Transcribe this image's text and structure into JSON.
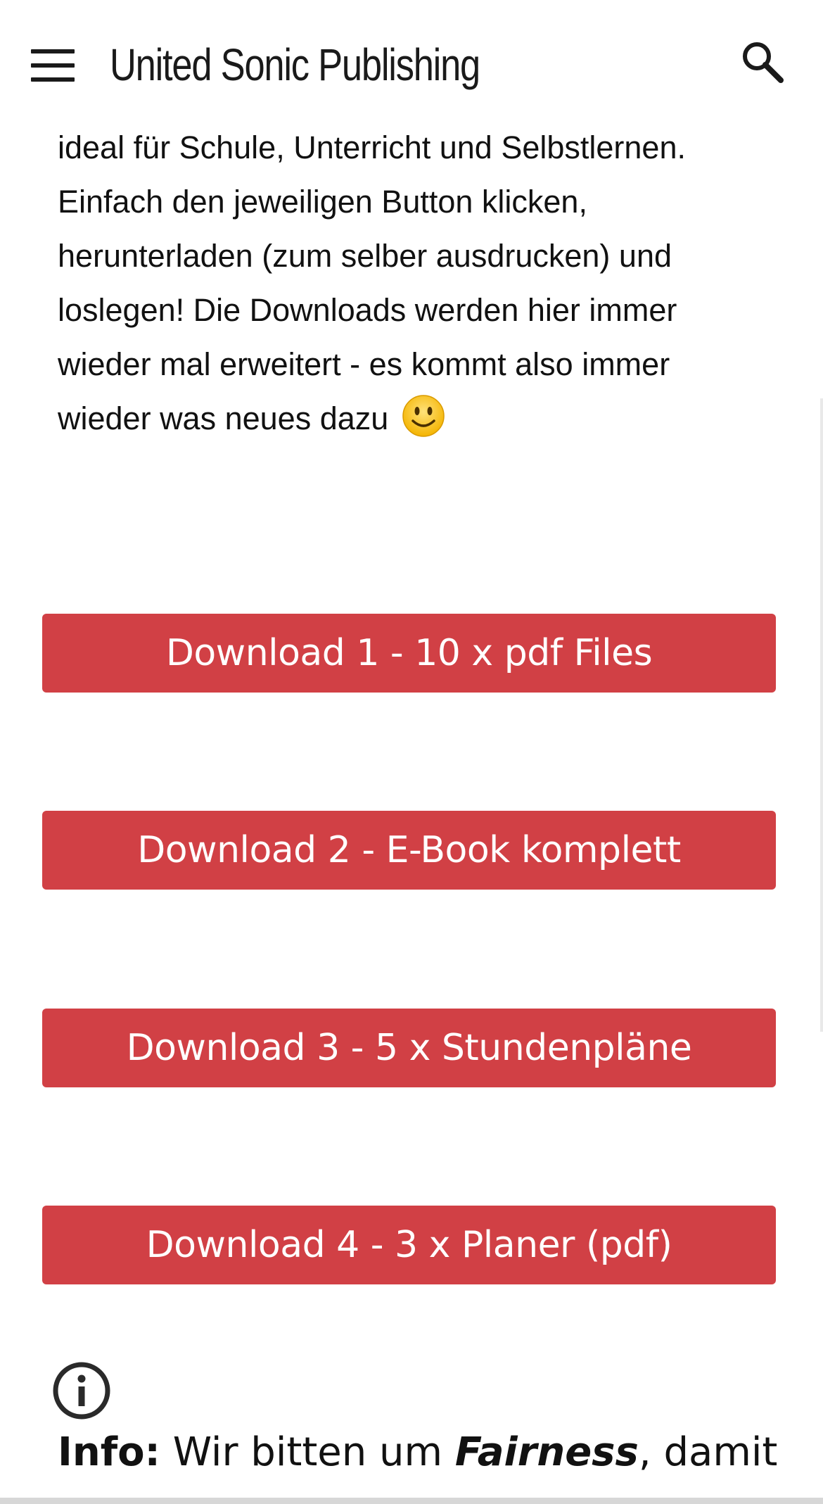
{
  "header": {
    "menu_icon": "hamburger-menu-icon",
    "title": "United Sonic Publishing",
    "search_icon": "search-icon"
  },
  "intro": {
    "lines": [
      "ideal für Schule, Unterricht und Selbstlernen.",
      "Einfach den jeweiligen Button klicken,",
      "herunterladen (zum selber ausdrucken) und",
      "loslegen! Die Downloads werden hier immer",
      "wieder mal erweitert - es kommt also immer",
      "wieder was neues dazu"
    ],
    "emoji_icon": "smiley-face-icon"
  },
  "downloads": [
    {
      "label": "Download 1 - 10 x pdf Files"
    },
    {
      "label": "Download 2 - E-Book komplett"
    },
    {
      "label": "Download 3 - 5 x Stundenpläne"
    },
    {
      "label": "Download 4 - 3 x Planer (pdf)"
    }
  ],
  "info": {
    "icon": "info-circle-icon",
    "label": "Info:",
    "text_before": "Wir bitten um",
    "emphasis": "Fairness",
    "text_after": ", damit"
  },
  "colors": {
    "button_bg": "#d14045",
    "button_text": "#ffffff",
    "text": "#111111"
  }
}
